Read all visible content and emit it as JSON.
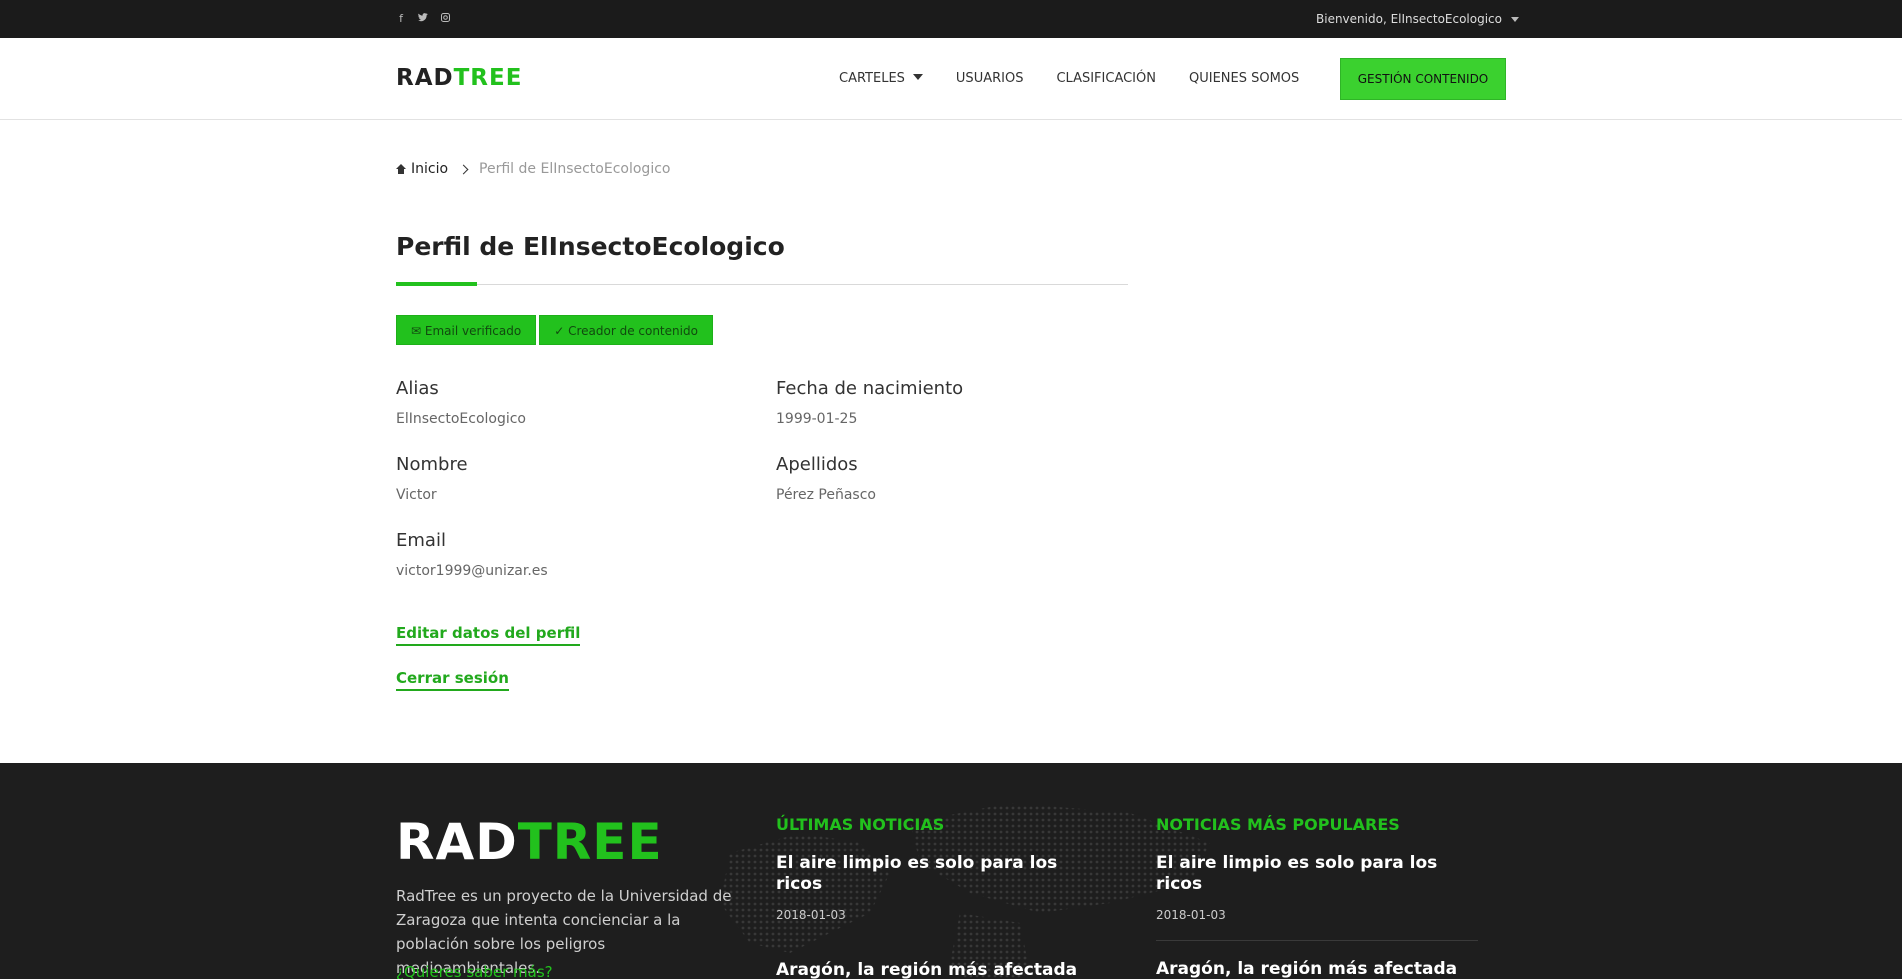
{
  "topbar": {
    "social_icons": [
      "facebook-icon",
      "twitter-icon",
      "instagram-icon"
    ],
    "welcome": "Bienvenido, ElInsectoEcologico"
  },
  "header": {
    "logo_black": "RAD",
    "logo_green": "TREE",
    "nav": [
      "CARTELES",
      "USUARIOS",
      "CLASIFICACIÓN",
      "QUIENES SOMOS"
    ],
    "cta": "GESTIÓN CONTENIDO"
  },
  "breadcrumb": {
    "home": "Inicio",
    "current": "Perfil de ElInsectoEcologico"
  },
  "profile": {
    "title": "Perfil de ElInsectoEcologico",
    "badges": [
      "Email verificado",
      "Creador de contenido"
    ],
    "fields": [
      {
        "label": "Alias",
        "value": "ElInsectoEcologico"
      },
      {
        "label": "Fecha de nacimiento",
        "value": "1999-01-25"
      },
      {
        "label": "Nombre",
        "value": "Victor"
      },
      {
        "label": "Apellidos",
        "value": "Pérez Peñasco"
      },
      {
        "label": "Email",
        "value": "victor1999@unizar.es"
      }
    ],
    "edit_link": "Editar datos del perfil",
    "logout_link": "Cerrar sesión"
  },
  "footer": {
    "logo_white": "RAD",
    "logo_green": "TREE",
    "about": "RadTree es un proyecto de la Universidad de Zaragoza que intenta concienciar a la población sobre los peligros medioambientales.",
    "more": "¿Quieres saber más?",
    "latest": {
      "heading": "ÚLTIMAS NOTICIAS",
      "items": [
        {
          "title": "El aire limpio es solo para los ricos",
          "date": "2018-01-03"
        },
        {
          "title": "Aragón, la región más afectada por la construcción de embalses que están",
          "date": ""
        }
      ]
    },
    "popular": {
      "heading": "NOTICIAS MÁS POPULARES",
      "items": [
        {
          "title": "El aire limpio es solo para los ricos",
          "date": "2018-01-03"
        },
        {
          "title": "Aragón, la región más afectada por la construcción de embalses que están",
          "date": ""
        }
      ]
    }
  },
  "colors": {
    "accent": "#22c11d",
    "topbar": "#1b1b1b",
    "footer": "#1e1e1e"
  }
}
